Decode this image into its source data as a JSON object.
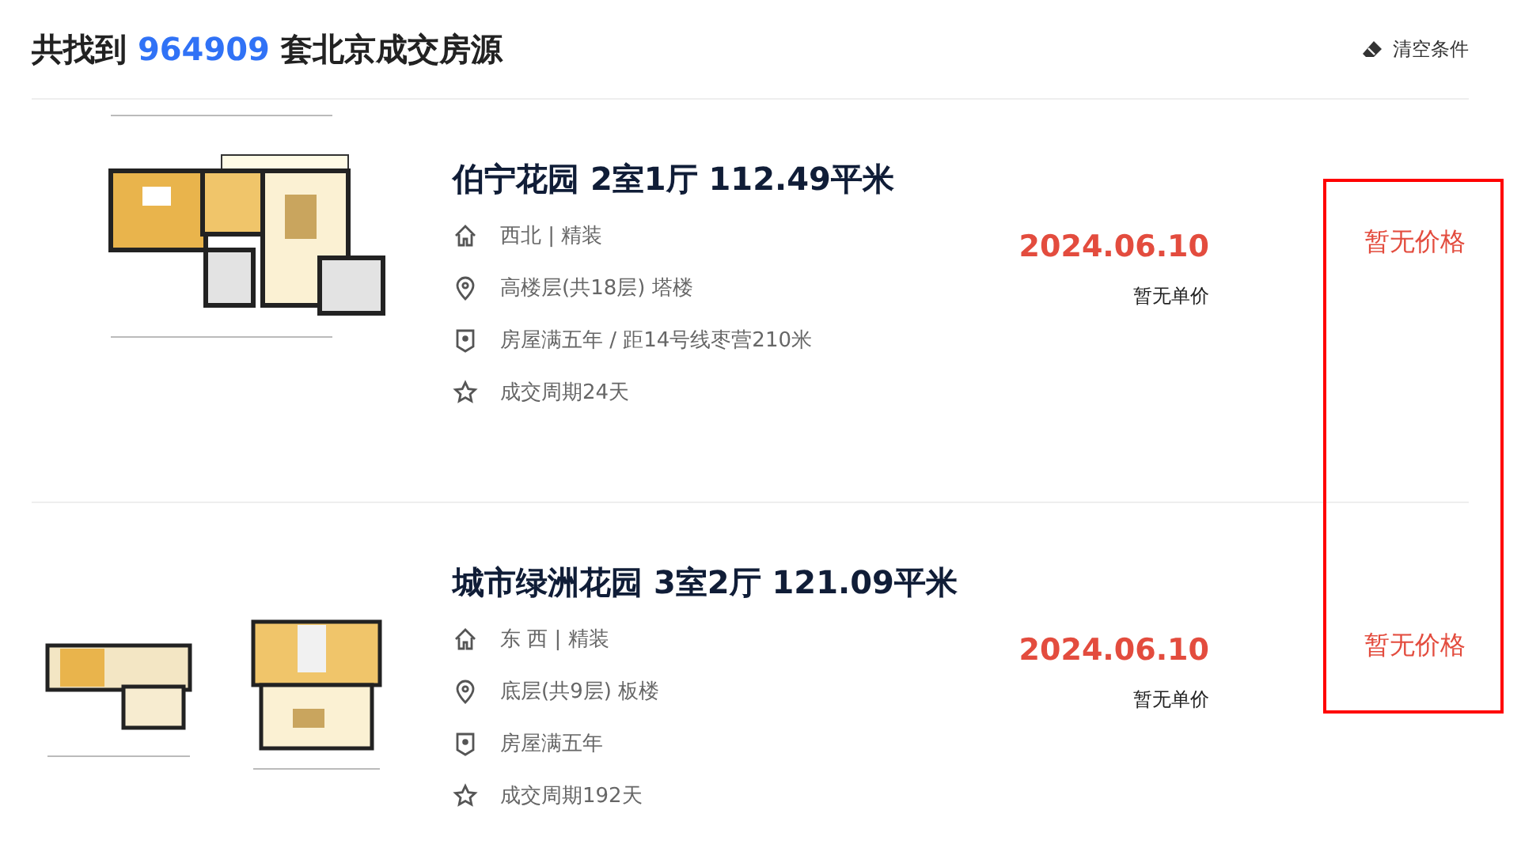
{
  "header": {
    "prefix": "共找到",
    "count": "964909",
    "suffix": "套北京成交房源",
    "clear_button": "清空条件"
  },
  "listings": [
    {
      "title": "伯宁花园 2室1厅 112.49平米",
      "info": [
        {
          "kind": "house",
          "text": "西北 | 精装"
        },
        {
          "kind": "location",
          "text": "高楼层(共18层) 塔楼"
        },
        {
          "kind": "badge",
          "text": "房屋满五年 / 距14号线枣营210米"
        },
        {
          "kind": "star",
          "text": "成交周期24天"
        }
      ],
      "date": "2024.06.10",
      "unit_price": "暂无单价",
      "total_price": "暂无价格"
    },
    {
      "title": "城市绿洲花园 3室2厅 121.09平米",
      "info": [
        {
          "kind": "house",
          "text": "东 西 | 精装"
        },
        {
          "kind": "location",
          "text": "底层(共9层) 板楼"
        },
        {
          "kind": "badge",
          "text": "房屋满五年"
        },
        {
          "kind": "star",
          "text": "成交周期192天"
        }
      ],
      "date": "2024.06.10",
      "unit_price": "暂无单价",
      "total_price": "暂无价格"
    }
  ]
}
